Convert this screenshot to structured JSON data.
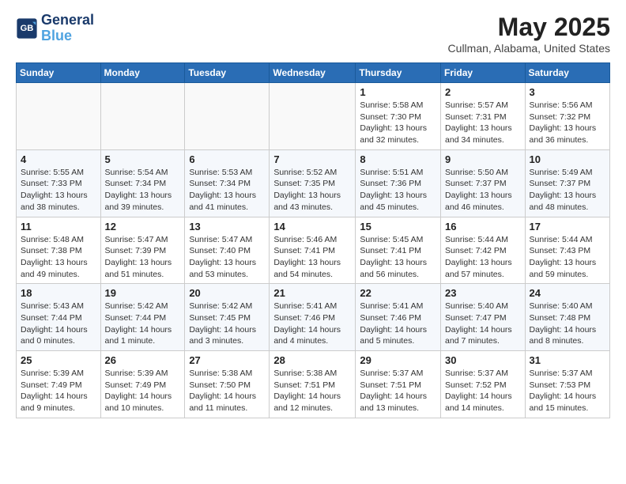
{
  "header": {
    "logo_line1": "General",
    "logo_line2": "Blue",
    "month": "May 2025",
    "location": "Cullman, Alabama, United States"
  },
  "weekdays": [
    "Sunday",
    "Monday",
    "Tuesday",
    "Wednesday",
    "Thursday",
    "Friday",
    "Saturday"
  ],
  "weeks": [
    [
      {
        "day": "",
        "info": ""
      },
      {
        "day": "",
        "info": ""
      },
      {
        "day": "",
        "info": ""
      },
      {
        "day": "",
        "info": ""
      },
      {
        "day": "1",
        "info": "Sunrise: 5:58 AM\nSunset: 7:30 PM\nDaylight: 13 hours\nand 32 minutes."
      },
      {
        "day": "2",
        "info": "Sunrise: 5:57 AM\nSunset: 7:31 PM\nDaylight: 13 hours\nand 34 minutes."
      },
      {
        "day": "3",
        "info": "Sunrise: 5:56 AM\nSunset: 7:32 PM\nDaylight: 13 hours\nand 36 minutes."
      }
    ],
    [
      {
        "day": "4",
        "info": "Sunrise: 5:55 AM\nSunset: 7:33 PM\nDaylight: 13 hours\nand 38 minutes."
      },
      {
        "day": "5",
        "info": "Sunrise: 5:54 AM\nSunset: 7:34 PM\nDaylight: 13 hours\nand 39 minutes."
      },
      {
        "day": "6",
        "info": "Sunrise: 5:53 AM\nSunset: 7:34 PM\nDaylight: 13 hours\nand 41 minutes."
      },
      {
        "day": "7",
        "info": "Sunrise: 5:52 AM\nSunset: 7:35 PM\nDaylight: 13 hours\nand 43 minutes."
      },
      {
        "day": "8",
        "info": "Sunrise: 5:51 AM\nSunset: 7:36 PM\nDaylight: 13 hours\nand 45 minutes."
      },
      {
        "day": "9",
        "info": "Sunrise: 5:50 AM\nSunset: 7:37 PM\nDaylight: 13 hours\nand 46 minutes."
      },
      {
        "day": "10",
        "info": "Sunrise: 5:49 AM\nSunset: 7:37 PM\nDaylight: 13 hours\nand 48 minutes."
      }
    ],
    [
      {
        "day": "11",
        "info": "Sunrise: 5:48 AM\nSunset: 7:38 PM\nDaylight: 13 hours\nand 49 minutes."
      },
      {
        "day": "12",
        "info": "Sunrise: 5:47 AM\nSunset: 7:39 PM\nDaylight: 13 hours\nand 51 minutes."
      },
      {
        "day": "13",
        "info": "Sunrise: 5:47 AM\nSunset: 7:40 PM\nDaylight: 13 hours\nand 53 minutes."
      },
      {
        "day": "14",
        "info": "Sunrise: 5:46 AM\nSunset: 7:41 PM\nDaylight: 13 hours\nand 54 minutes."
      },
      {
        "day": "15",
        "info": "Sunrise: 5:45 AM\nSunset: 7:41 PM\nDaylight: 13 hours\nand 56 minutes."
      },
      {
        "day": "16",
        "info": "Sunrise: 5:44 AM\nSunset: 7:42 PM\nDaylight: 13 hours\nand 57 minutes."
      },
      {
        "day": "17",
        "info": "Sunrise: 5:44 AM\nSunset: 7:43 PM\nDaylight: 13 hours\nand 59 minutes."
      }
    ],
    [
      {
        "day": "18",
        "info": "Sunrise: 5:43 AM\nSunset: 7:44 PM\nDaylight: 14 hours\nand 0 minutes."
      },
      {
        "day": "19",
        "info": "Sunrise: 5:42 AM\nSunset: 7:44 PM\nDaylight: 14 hours\nand 1 minute."
      },
      {
        "day": "20",
        "info": "Sunrise: 5:42 AM\nSunset: 7:45 PM\nDaylight: 14 hours\nand 3 minutes."
      },
      {
        "day": "21",
        "info": "Sunrise: 5:41 AM\nSunset: 7:46 PM\nDaylight: 14 hours\nand 4 minutes."
      },
      {
        "day": "22",
        "info": "Sunrise: 5:41 AM\nSunset: 7:46 PM\nDaylight: 14 hours\nand 5 minutes."
      },
      {
        "day": "23",
        "info": "Sunrise: 5:40 AM\nSunset: 7:47 PM\nDaylight: 14 hours\nand 7 minutes."
      },
      {
        "day": "24",
        "info": "Sunrise: 5:40 AM\nSunset: 7:48 PM\nDaylight: 14 hours\nand 8 minutes."
      }
    ],
    [
      {
        "day": "25",
        "info": "Sunrise: 5:39 AM\nSunset: 7:49 PM\nDaylight: 14 hours\nand 9 minutes."
      },
      {
        "day": "26",
        "info": "Sunrise: 5:39 AM\nSunset: 7:49 PM\nDaylight: 14 hours\nand 10 minutes."
      },
      {
        "day": "27",
        "info": "Sunrise: 5:38 AM\nSunset: 7:50 PM\nDaylight: 14 hours\nand 11 minutes."
      },
      {
        "day": "28",
        "info": "Sunrise: 5:38 AM\nSunset: 7:51 PM\nDaylight: 14 hours\nand 12 minutes."
      },
      {
        "day": "29",
        "info": "Sunrise: 5:37 AM\nSunset: 7:51 PM\nDaylight: 14 hours\nand 13 minutes."
      },
      {
        "day": "30",
        "info": "Sunrise: 5:37 AM\nSunset: 7:52 PM\nDaylight: 14 hours\nand 14 minutes."
      },
      {
        "day": "31",
        "info": "Sunrise: 5:37 AM\nSunset: 7:53 PM\nDaylight: 14 hours\nand 15 minutes."
      }
    ]
  ]
}
